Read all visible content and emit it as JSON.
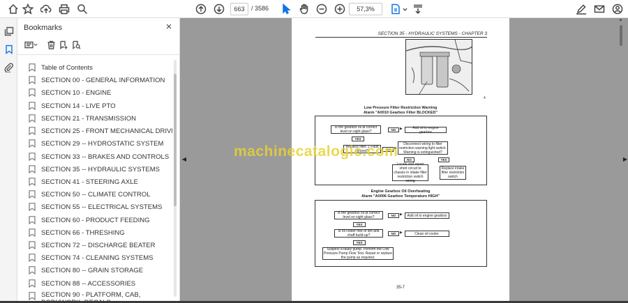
{
  "toolbar": {
    "page_current": "663",
    "page_total": "/ 3586",
    "zoom": "57,3%"
  },
  "bookmarks": {
    "title": "Bookmarks",
    "close": "×",
    "items": [
      {
        "label": "Table of Contents"
      },
      {
        "label": "SECTION 00 - GENERAL INFORMATION"
      },
      {
        "label": "SECTION 10 - ENGINE"
      },
      {
        "label": "SECTION 14 - LIVE PTO"
      },
      {
        "label": "SECTION 21 - TRANSMISSION"
      },
      {
        "label": "SECTION 25 - FRONT MECHANICAL DRIVE"
      },
      {
        "label": "SECTION 29 -- HYDROSTATIC SYSTEM"
      },
      {
        "label": "SECTION 33 -- BRAKES AND CONTROLS"
      },
      {
        "label": "SECTION 35 -- HYDRAULIC SYSTEMS"
      },
      {
        "label": "SECTION 41 - STEERING AXLE"
      },
      {
        "label": "SECTION 50 -- CLIMATE CONTROL"
      },
      {
        "label": "SECTION 55 -- ELECTRICAL SYSTEMS"
      },
      {
        "label": "SECTION 60 - PRODUCT FEEDING"
      },
      {
        "label": "SECTION 66 - THRESHING"
      },
      {
        "label": "SECTION 72 -- DISCHARGE BEATER"
      },
      {
        "label": "SECTION 74 - CLEANING SYSTEMS"
      },
      {
        "label": "SECTION 80 -- GRAIN STORAGE"
      },
      {
        "label": "SECTION 88 -- ACCESSORIES"
      },
      {
        "label": "SECTION 90 - PLATFORM, CAB, BODYWORK, DECALS"
      }
    ]
  },
  "document": {
    "header": "SECTION 35 - HYDRAULIC SYSTEMS - CHAPTER 3",
    "photo_number": "1",
    "photo_code": "70020028",
    "photo_caption": "4",
    "chart1": {
      "title1": "Low Pressure Filter Restriction Warning",
      "title2": "Alarm \"A0010 Gearbox Filter BLOCKED\"",
      "q1": "Is the gearbox oil at correct level on sight glass?",
      "no": "NO",
      "yes": "YES",
      "a1": "Add oil to engine gearbox",
      "a2": "Replace filter, 1 Fault cleared?",
      "a3": "Disconnect wiring to filter restriction warning light switch. Warning is extinguished?",
      "a4": "Locate and repair short circuit to chassis in intake filter restriction switch wiring",
      "a5": "Replace intake filter restriction switch"
    },
    "chart2": {
      "title1": "Engine Gearbox Oil Overheating",
      "title2": "Alarm \"A0006 Gearbox Temperature HIGH\"",
      "q1": "Is the gearbox oil at correct level on sight glass?",
      "a1": "Add oil to engine gearbox",
      "q2": "Is oil cooler free of dirt and chaff build-up?",
      "a2": "Clean oil cooler.",
      "a3": "Suspect a faulty pump. Perform the Low Pressure Pump Flow Test. Repair or replace the pump as required."
    },
    "page_number": "35-7"
  },
  "watermark": "machinecatalogic.com"
}
